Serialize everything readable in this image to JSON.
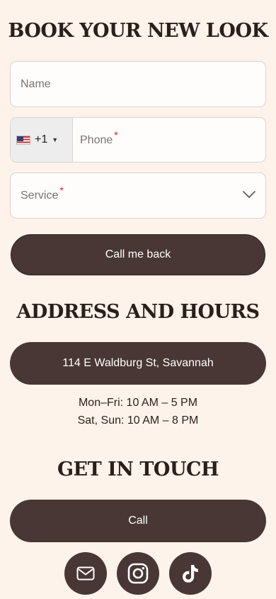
{
  "booking": {
    "title": "BOOK YOUR NEW LOOK",
    "name_placeholder": "Name",
    "phone_country_code": "+1",
    "phone_placeholder": "Phone",
    "service_placeholder": "Service",
    "required_mark": "*",
    "submit_label": "Call me back"
  },
  "address": {
    "title": "ADDRESS AND HOURS",
    "address_button": "114 E Waldburg St, Savannah",
    "hours": [
      "Mon–Fri: 10 AM – 5 PM",
      "Sat, Sun: 10 AM – 8 PM"
    ]
  },
  "contact": {
    "title": "GET IN TOUCH",
    "call_label": "Call",
    "social_icons": [
      "mail-icon",
      "instagram-icon",
      "tiktok-icon"
    ]
  },
  "colors": {
    "background": "#fdf3ea",
    "button": "#483734",
    "heading": "#2b1f1c",
    "required": "#d11a1a"
  }
}
